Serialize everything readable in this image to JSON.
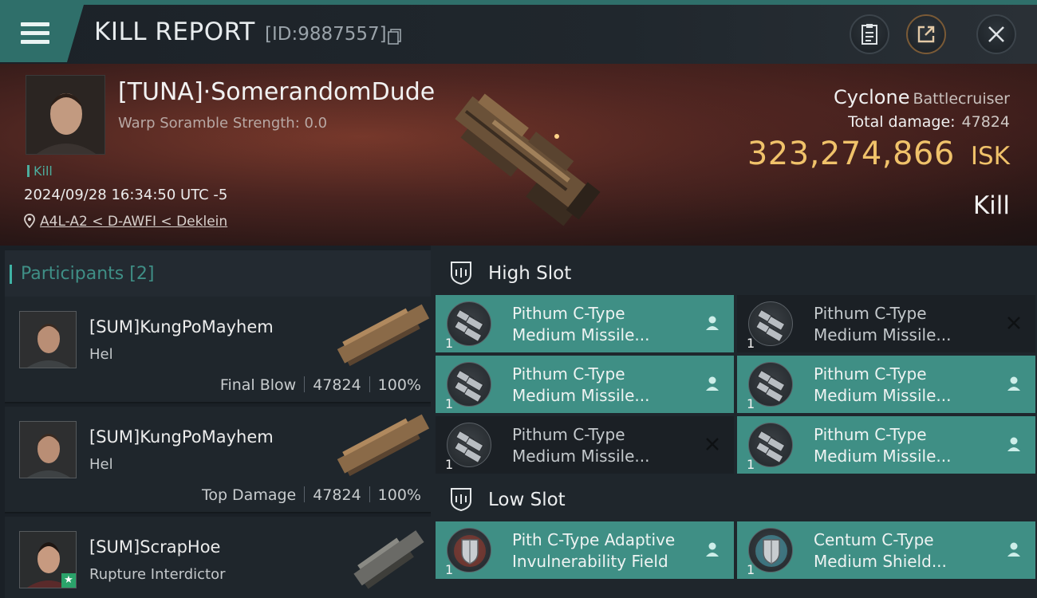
{
  "header": {
    "title": "KILL REPORT",
    "report_id": "[ID:9887557]"
  },
  "victim": {
    "name": "[TUNA]·SomerandomDude",
    "scramble": "Warp Soramble Strength: 0.0",
    "tag": "Kill",
    "datetime": "2024/09/28 16:34:50 UTC -5",
    "location": "A4L-A2 < D-AWFI < Deklein",
    "ship_name": "Cyclone",
    "ship_class": "Battlecruiser",
    "total_damage_label": "Total damage:",
    "total_damage": "47824",
    "isk_value": "323,274,866",
    "isk_unit": "ISK",
    "result": "Kill"
  },
  "participants": {
    "title": "Participants",
    "count": "[2]",
    "rows": [
      {
        "name": "[SUM]KungPoMayhem",
        "ship": "Hel",
        "role": "Final Blow",
        "damage": "47824",
        "percent": "100%"
      },
      {
        "name": "[SUM]KungPoMayhem",
        "ship": "Hel",
        "role": "Top Damage",
        "damage": "47824",
        "percent": "100%"
      },
      {
        "name": "[SUM]ScrapHoe",
        "ship": "Rupture Interdictor"
      }
    ]
  },
  "slots": {
    "high_title": "High Slot",
    "low_title": "Low Slot",
    "high": [
      {
        "line1": "Pithum C-Type",
        "line2": "Medium Missile...",
        "qty": "1",
        "status": "person"
      },
      {
        "line1": "Pithum C-Type",
        "line2": "Medium Missile...",
        "qty": "1",
        "status": "destroyed"
      },
      {
        "line1": "Pithum C-Type",
        "line2": "Medium Missile...",
        "qty": "1",
        "status": "person"
      },
      {
        "line1": "Pithum C-Type",
        "line2": "Medium Missile...",
        "qty": "1",
        "status": "person"
      },
      {
        "line1": "Pithum C-Type",
        "line2": "Medium Missile...",
        "qty": "1",
        "status": "destroyed"
      },
      {
        "line1": "Pithum C-Type",
        "line2": "Medium Missile...",
        "qty": "1",
        "status": "person"
      }
    ],
    "low": [
      {
        "line1": "Pith C-Type Adaptive",
        "line2": "Invulnerability Field",
        "qty": "1",
        "status": "person"
      },
      {
        "line1": "Centum C-Type",
        "line2": "Medium Shield...",
        "qty": "1",
        "status": "person"
      }
    ]
  },
  "colors": {
    "accent_teal": "#3f8f85",
    "isk_gold": "#f0c26a",
    "kill_green": "#4cae9e"
  }
}
